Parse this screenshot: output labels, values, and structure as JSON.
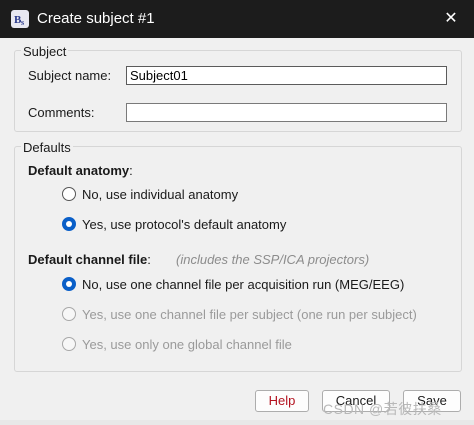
{
  "window": {
    "title": "Create subject #1",
    "app_icon": "brainstorm-icon",
    "close_glyph": "✕"
  },
  "subject": {
    "legend": "Subject",
    "name_label": "Subject name:",
    "name_value": "Subject01",
    "comments_label": "Comments:",
    "comments_value": ""
  },
  "defaults": {
    "legend": "Defaults",
    "anatomy_heading": "Default anatomy",
    "anatomy_colon": ":",
    "anatomy_options": [
      {
        "label": "No, use individual anatomy",
        "selected": false,
        "enabled": true
      },
      {
        "label": "Yes, use protocol's default anatomy",
        "selected": true,
        "enabled": true
      }
    ],
    "channel_heading": "Default channel file",
    "channel_colon": ":",
    "channel_hint": "(includes the SSP/ICA projectors)",
    "channel_options": [
      {
        "label": "No, use one channel file per acquisition run (MEG/EEG)",
        "selected": true,
        "enabled": true
      },
      {
        "label": "Yes, use one channel file per subject  (one run per subject)",
        "selected": false,
        "enabled": false
      },
      {
        "label": "Yes, use only one global channel file",
        "selected": false,
        "enabled": false
      }
    ]
  },
  "buttons": {
    "help": "Help",
    "cancel": "Cancel",
    "save": "Save"
  },
  "watermark": "CSDN @若彼扶桑",
  "colors": {
    "titlebar": "#1c1c1c",
    "accent": "#0a5fc8",
    "help_text": "#b3121f"
  }
}
